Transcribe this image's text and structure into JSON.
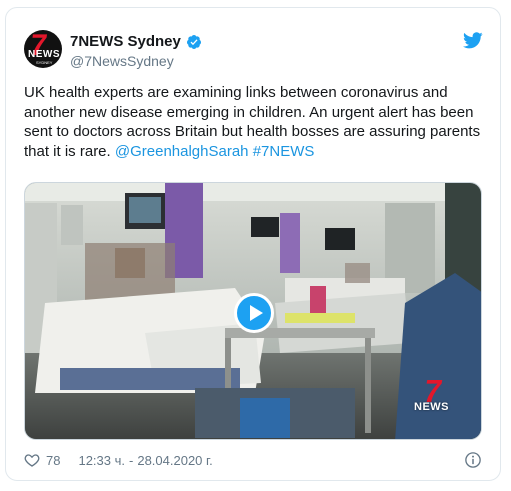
{
  "tweet": {
    "display_name": "7NEWS Sydney",
    "handle": "@7NewsSydney",
    "avatar": {
      "logo_text": "7",
      "logo_sub": "NEWS",
      "logo_small": "SYDNEY"
    },
    "text_main": "UK health experts are examining links between coronavirus and another new disease emerging in children. An urgent alert has been sent to doctors across Britain but health bosses are assuring parents that it is rare. ",
    "mention": "@GreenhalghSarah",
    "hashtag": "#7NEWS",
    "media": {
      "watermark_numeral": "7",
      "watermark_text": "NEWS",
      "play_icon": "play-icon"
    },
    "likes": "78",
    "time": "12:33 ч.",
    "separator": "-",
    "date": "28.04.2020 г."
  },
  "icons": {
    "verified": "verified-badge-icon",
    "bird": "twitter-bird-icon",
    "heart": "heart-icon",
    "info": "info-icon"
  },
  "colors": {
    "accent": "#1da1f2",
    "link": "#1b95e0",
    "secondary_text": "#657786",
    "brand_red": "#e3172b"
  }
}
